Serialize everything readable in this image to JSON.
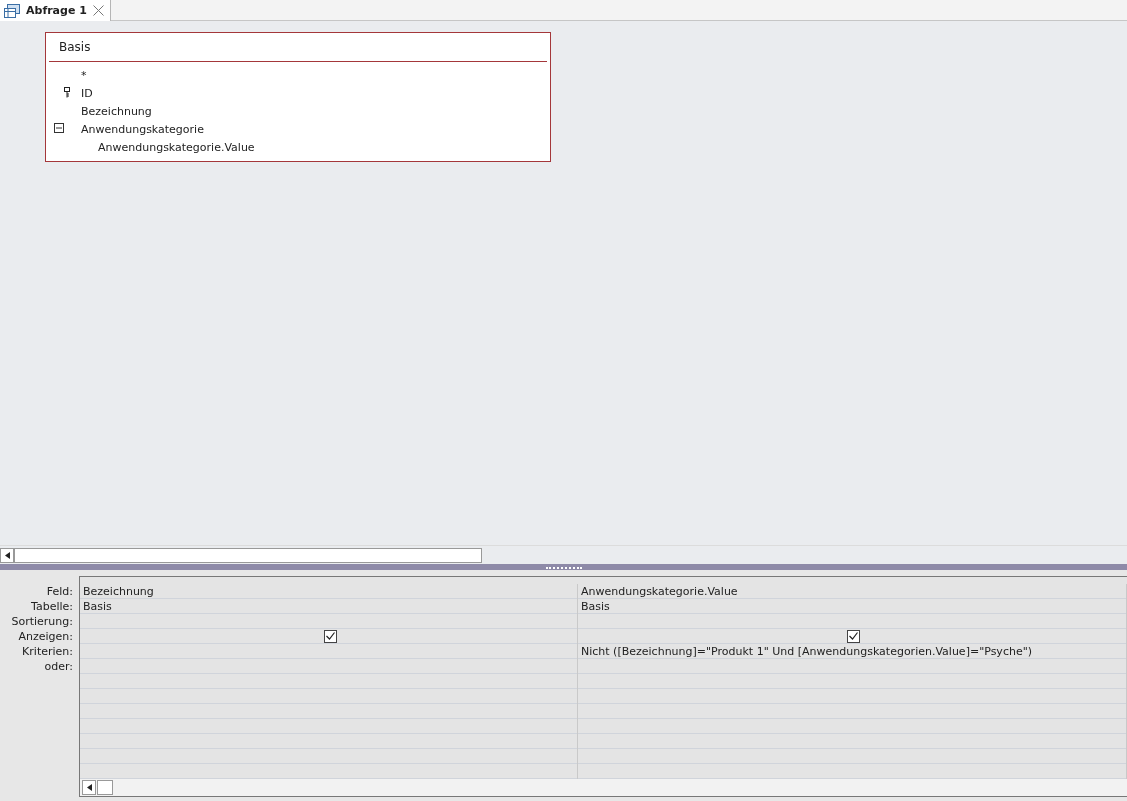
{
  "tab": {
    "title": "Abfrage 1",
    "selected": true
  },
  "table": {
    "title": "Basis",
    "fields": [
      {
        "name": "*",
        "kind": "plain"
      },
      {
        "name": "ID",
        "kind": "key"
      },
      {
        "name": "Bezeichnung",
        "kind": "plain"
      },
      {
        "name": "Anwendungskategorie",
        "kind": "plain",
        "expanded": true,
        "children": [
          {
            "name": "Anwendungskategorie.Value"
          }
        ]
      }
    ]
  },
  "grid": {
    "row_labels": [
      "Feld:",
      "Tabelle:",
      "Sortierung:",
      "Anzeigen:",
      "Kriterien:",
      "oder:"
    ],
    "columns": [
      {
        "field": "Bezeichnung",
        "table": "Basis",
        "show": true
      },
      {
        "field": "Anwendungskategorie.Value",
        "table": "Basis",
        "show": true,
        "criteria": "Nicht ([Bezeichnung]=\"Produkt 1\" Und [Anwendungskategorien.Value]=\"Psyche\")"
      }
    ]
  }
}
